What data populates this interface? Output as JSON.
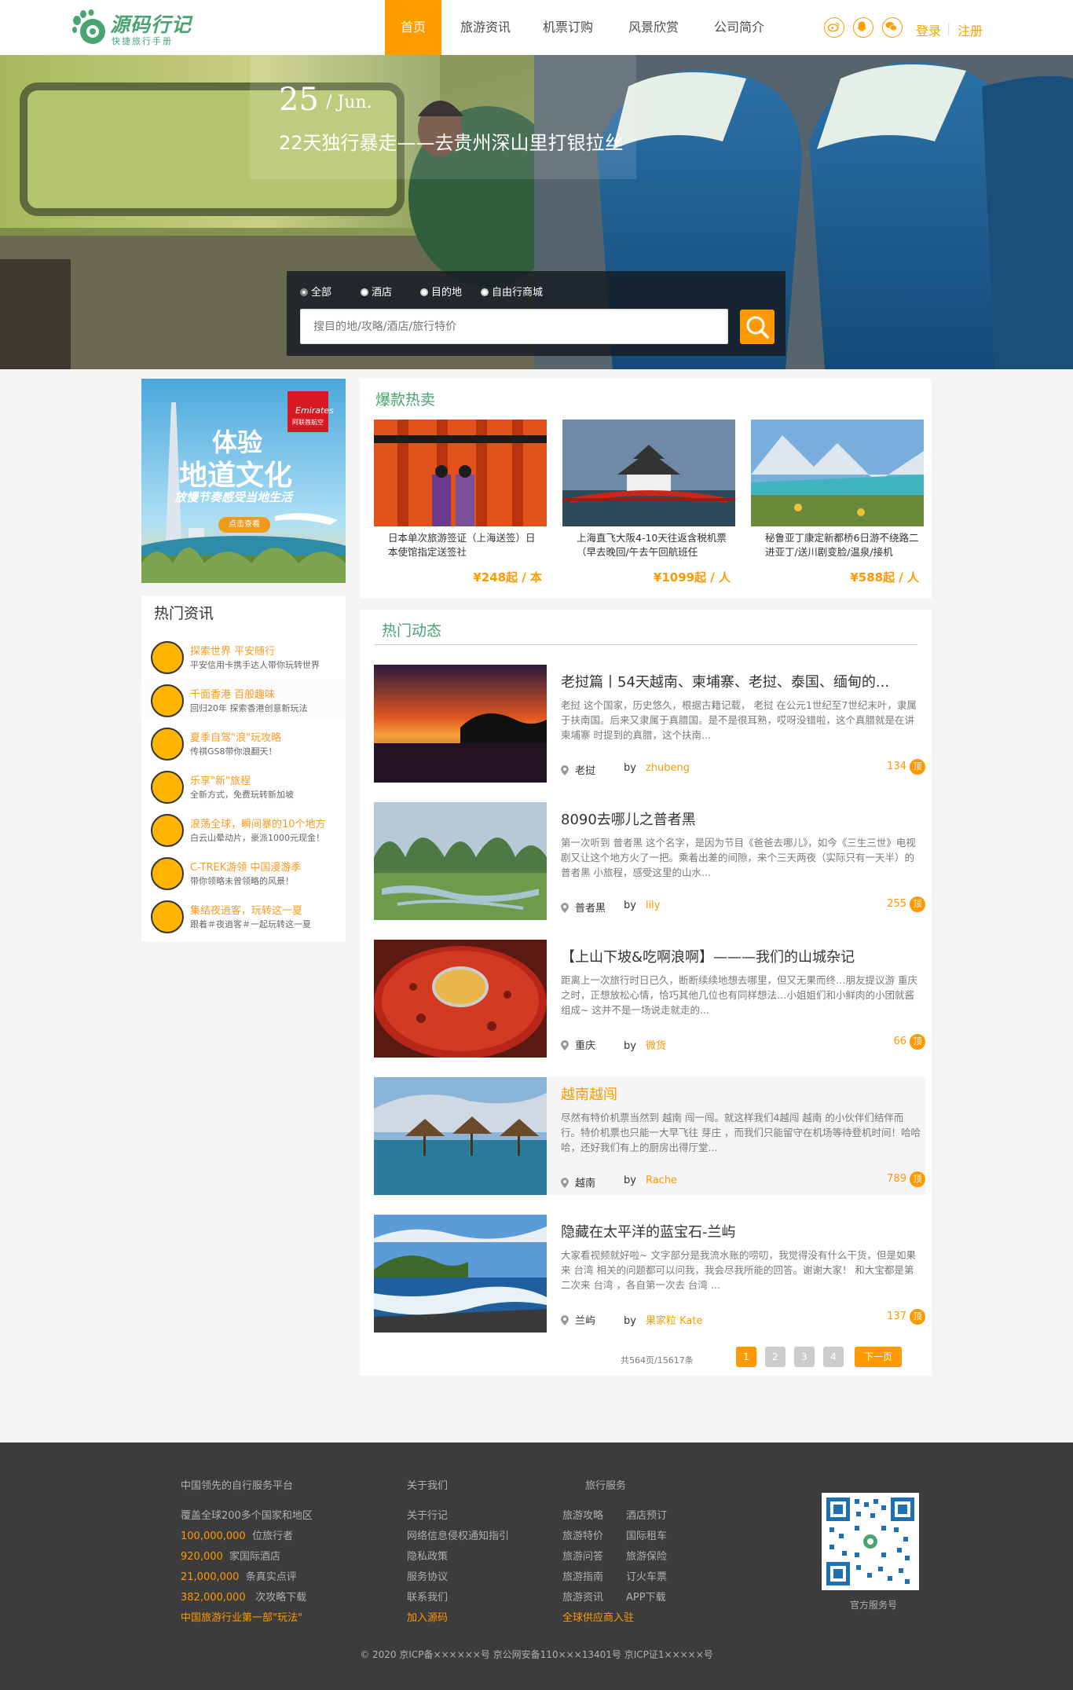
{
  "header": {
    "logo_title": "源码行记",
    "logo_sub": "快捷旅行手册",
    "nav": [
      "首页",
      "旅游资讯",
      "机票订购",
      "风景欣赏",
      "公司简介"
    ],
    "login": "登录",
    "separator": "|",
    "register": "注册",
    "colors": {
      "accent": "#ff9d00",
      "nav_text": "#4b4b4b",
      "brand_green": "#49a472",
      "link": "#fe9e00"
    }
  },
  "banner": {
    "day": "25",
    "month": "/ Jun.",
    "title": "22天独行暴走——去贵州深山里打银拉丝"
  },
  "search": {
    "options": [
      "全部",
      "酒店",
      "目的地",
      "自由行商城"
    ],
    "placeholder": "搜目的地/攻略/酒店/旅行特价",
    "button_icon": "search-icon"
  },
  "ad": {
    "brand": "Emirates",
    "brand_sub": "阿联酋航空",
    "line1": "体验",
    "line2": "地道文化",
    "line3": "放慢节奏感受当地生活",
    "button": "点击查看"
  },
  "news": {
    "heading": "热门资讯",
    "items": [
      {
        "title": "探索世界 平安随行",
        "sub": "平安信用卡携手达人带你玩转世界"
      },
      {
        "title": "千面香港 百般趣味",
        "sub": "回归20年 探索香港创意新玩法"
      },
      {
        "title": "夏季自驾\"浪\"玩攻略",
        "sub": "传祺GS8带你浪翻天！"
      },
      {
        "title": "乐享\"新\"旅程",
        "sub": "全新方式，免费玩转新加坡"
      },
      {
        "title": "浪荡全球，瞬间暴的10个地方",
        "sub": "白云山晕动片，豪派1000元现金！"
      },
      {
        "title": "C-TREK游领 中国漫游季",
        "sub": "带你领略未曾领略的风景！"
      },
      {
        "title": "集结夜逍客，玩转这一夏",
        "sub": "跟着＃夜逍客＃一起玩转这一夏"
      }
    ]
  },
  "sale": {
    "heading": "爆款热卖",
    "cards": [
      {
        "text": "日本单次旅游签证（上海送签）日本使馆指定送签社",
        "price": "¥248起 / 本"
      },
      {
        "text": "上海直飞大阪4-10天往返含税机票（早去晚回/午去午回航班任",
        "price": "¥1099起 / 人"
      },
      {
        "text": "秘鲁亚丁康定新都桥6日游不绕路二进亚丁/送川剧变脸/温泉/接机",
        "price": "¥588起 / 人"
      }
    ]
  },
  "dynamic": {
    "heading": "热门动态",
    "posts": [
      {
        "title": "老挝篇丨54天越南、柬埔寨、老挝、泰国、缅甸的...",
        "desc": "老挝 这个国家，历史悠久，根据古籍记载， 老挝 在公元1世纪至7世纪末叶，隶属于扶南国。后来又隶属于真腊国。是不是很耳熟，哎呀没错啦，这个真腊就是在讲 柬埔寨 时提到的真腊，这个扶南...",
        "place": "老挝",
        "by": "by",
        "author": "zhubeng",
        "count": "134",
        "top": "顶"
      },
      {
        "title": "8090去哪儿之普者黑",
        "desc": "第一次听到 普者黑 这个名字，是因为节目《爸爸去哪儿》，如今《三生三世》电视剧又让这个地方火了一把。乘着出差的间隙，来个三天两夜（实际只有一天半）的 普者黑 小旅程，感受这里的山水...",
        "place": "普者黑",
        "by": "by",
        "author": "lily",
        "count": "255",
        "top": "顶"
      },
      {
        "title": "【上山下坡&吃啊浪啊】———我们的山城杂记",
        "desc": "距离上一次旅行时日已久，断断续续地想去哪里，但又无果而终…朋友提议游 重庆 之时，正想放松心情，恰巧其他几位也有同样想法…小姐姐们和小鲜肉的小团就酱组成~ 这并不是一场说走就走的...",
        "place": "重庆",
        "by": "by",
        "author": "微货",
        "count": "66",
        "top": "顶"
      },
      {
        "title": "越南越闯",
        "desc": "尽然有特价机票当然到 越南 闯一闯。就这样我们4越闯 越南 的小伙伴们结伴而行。特价机票也只能一大早飞往 芽庄 ，而我们只能留守在机场等待登机时间！哈哈哈，还好我们有上的厨房出得厅堂...",
        "place": "越南",
        "by": "by",
        "author": "Rache",
        "count": "789",
        "top": "顶"
      },
      {
        "title": "隐藏在太平洋的蓝宝石-兰屿",
        "desc": "大家看视频就好啦~ 文字部分是我流水账的唠叨，我觉得没有什么干货，但是如果来 台湾 相关的问题都可以问我，我会尽我所能的回答。谢谢大家！ 和大宝都是第二次来 台湾 ，各自第一次去 台湾 ...",
        "place": "兰屿",
        "by": "by",
        "author": "果家粒 Kate",
        "count": "137",
        "top": "顶"
      }
    ]
  },
  "pager": {
    "info": "共564页/15617条",
    "pages": [
      "1",
      "2",
      "3",
      "4"
    ],
    "next": "下一页"
  },
  "footer": {
    "col1_title": "中国领先的自行服务平台",
    "col1_line": "覆盖全球200多个国家和地区",
    "stats": [
      {
        "num": "100,000,000",
        "label": "位旅行者"
      },
      {
        "num": "920,000",
        "label": "家国际酒店"
      },
      {
        "num": "21,000,000",
        "label": "条真实点评"
      },
      {
        "num": "382,000,000",
        "label": "次攻略下载"
      }
    ],
    "col1_slogan": "中国旅游行业第一部\"玩法\"",
    "col2_title": "关于我们",
    "col2_links": [
      "关于行记",
      "网络信息侵权通知指引",
      "隐私政策",
      "服务协议",
      "联系我们"
    ],
    "col2_highlight": "加入源码",
    "col3_title": "旅行服务",
    "col3_links_a": [
      "旅游攻略",
      "旅游特价",
      "旅游问答",
      "旅游指南",
      "旅游资讯"
    ],
    "col3_links_b": [
      "酒店预订",
      "国际租车",
      "旅游保险",
      "订火车票",
      "APP下载"
    ],
    "col3_highlight": "全球供应商入驻",
    "qr_label": "官方服务号",
    "copyright": "© 2020 京ICP备××××××号 京公网安备110×××13401号 京ICP证1×××××号"
  }
}
